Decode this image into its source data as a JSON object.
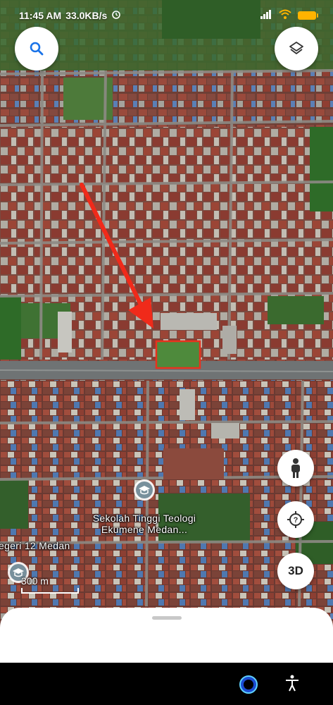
{
  "status_bar": {
    "time": "11:45 AM",
    "speed": "33.0KB/s",
    "alarm_icon": "alarm-icon",
    "signal_icon": "signal-icon",
    "wifi_icon": "wifi-icon",
    "battery_icon": "battery-icon"
  },
  "map": {
    "place_label_line1": "Sekolah Tinggi Teologi",
    "place_label_line2": "Ekumene Medan...",
    "partial_label": "egeri 12 Medan",
    "scale_label": "300 m",
    "colors": {
      "arrow": "#f02a1a",
      "highlight_box": "#e8321e",
      "road": "#6f7374",
      "roof_red": "#8a3a30",
      "vegetation": "#2e6b28"
    }
  },
  "controls": {
    "search_icon": "search-icon",
    "layers_icon": "layers-icon",
    "street_view_icon": "pegman-icon",
    "my_location_icon": "my-location-icon",
    "three_d_label": "3D"
  },
  "bottom_sheet": {
    "handle": "drag-handle"
  },
  "nav_bar": {
    "assistant_icon": "assistant-icon",
    "accessibility_icon": "accessibility-icon"
  }
}
